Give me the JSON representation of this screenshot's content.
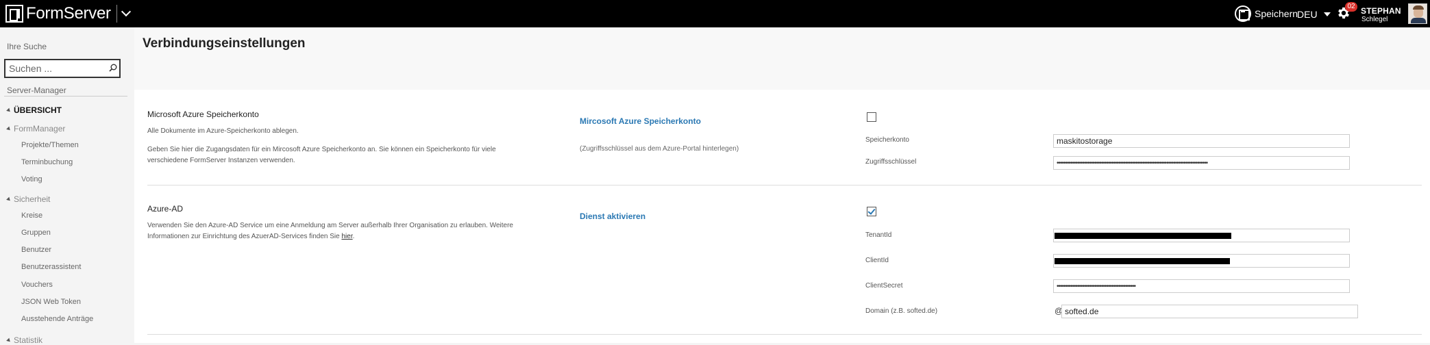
{
  "topbar": {
    "brand": "FormServer",
    "save_label": "Speichern",
    "language": "DEU",
    "notification_count": "02",
    "user_first": "STEPHAN",
    "user_last": "Schlegel"
  },
  "sidebar": {
    "search_heading": "Ihre Suche",
    "search_placeholder": "Suchen ...",
    "server_manager": "Server-Manager",
    "overview": "ÜBERSICHT",
    "groups": [
      {
        "label": "FormManager",
        "items": [
          "Projekte/Themen",
          "Terminbuchung",
          "Voting"
        ]
      },
      {
        "label": "Sicherheit",
        "items": [
          "Kreise",
          "Gruppen",
          "Benutzer",
          "Benutzerassistent",
          "Vouchers",
          "JSON Web Token",
          "Ausstehende Anträge"
        ]
      },
      {
        "label": "Statistik",
        "items": []
      }
    ]
  },
  "page": {
    "title": "Verbindungseinstellungen"
  },
  "sections": {
    "azure_storage": {
      "title": "Microsoft Azure Speicherkonto",
      "desc1": "Alle Dokumente im Azure-Speicherkonto ablegen.",
      "desc2": "Geben Sie hier die Zugangsdaten für ein Mircosoft Azure Speicherkonto an. Sie können ein Speicherkonto für viele",
      "desc3": "verschiedene FormServer Instanzen verwenden.",
      "heading": "Mircosoft Azure Speicherkonto",
      "note": "(Zugriffsschlüssel aus dem Azure-Portal hinterlegen)",
      "enabled": false,
      "account_label": "Speicherkonto",
      "account_value": "maskitostorage",
      "key_label": "Zugriffsschlüssel",
      "key_value": "••••••••••••••••••••••••••••••••••••••••••••••••••••••••••••••••••••••••••••••••••••••••"
    },
    "azure_ad": {
      "title": "Azure-AD",
      "desc1": "Verwenden Sie den Azure-AD Service um eine Anmeldung am Server außerhalb Ihrer Organisation zu erlauben. Weitere",
      "desc2_prefix": "Informationen zur Einrichtung des AzuerAD-Services finden Sie ",
      "desc2_link": "hier",
      "desc2_suffix": ".",
      "heading": "Dienst aktivieren",
      "enabled": true,
      "tenant_label": "TenantId",
      "client_label": "ClientId",
      "secret_label": "ClientSecret",
      "secret_value": "••••••••••••••••••••••••••••••••••••••••••••••",
      "domain_label": "Domain (z.B. softed.de)",
      "domain_prefix": "@",
      "domain_value": "softed.de"
    }
  }
}
